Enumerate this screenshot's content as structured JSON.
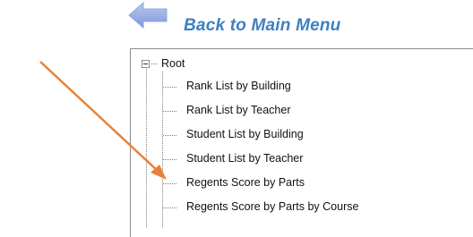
{
  "colors": {
    "link_blue": "#3f7fc4",
    "arrow_blue": "#8ea6e0",
    "annotation_orange": "#e8823a",
    "tree_line": "#808080"
  },
  "header": {
    "back_icon": "left-arrow-icon",
    "back_label": "Back to Main Menu"
  },
  "tree": {
    "root_label": "Root",
    "items": [
      "Rank List by Building",
      "Rank List by Teacher",
      "Student List by Building",
      "Student List by Teacher",
      "Regents Score by Parts",
      "Regents Score by Parts by Course"
    ]
  }
}
